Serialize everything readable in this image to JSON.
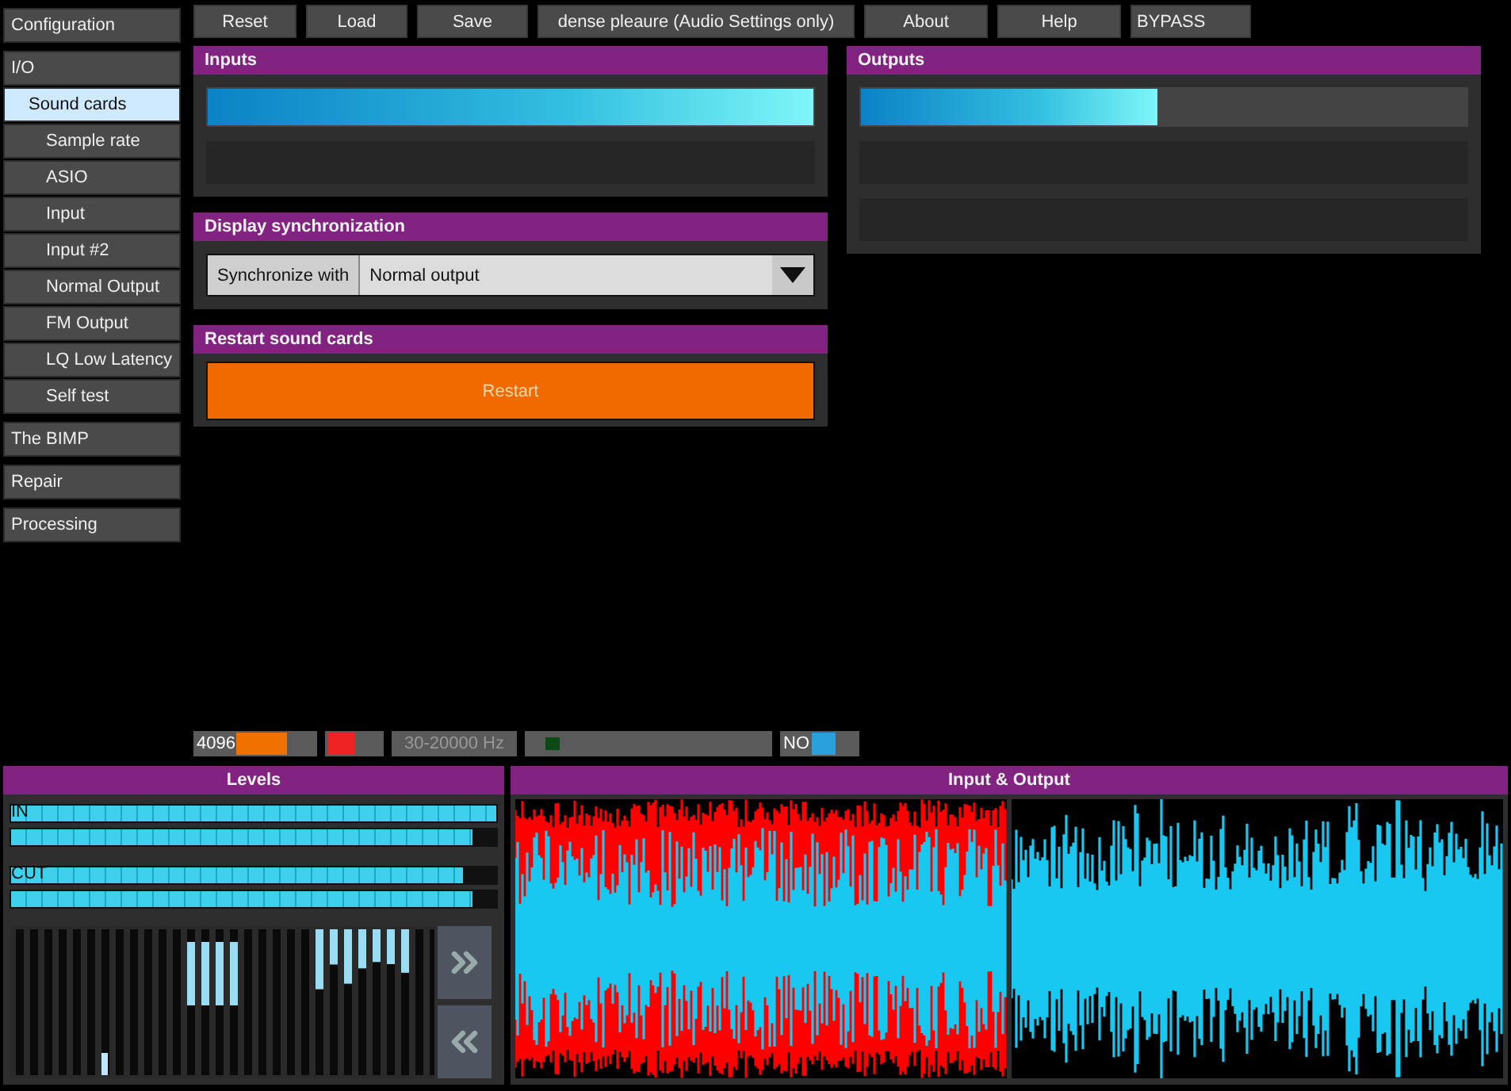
{
  "sidebar": {
    "items": [
      {
        "label": "Configuration",
        "selected": false
      },
      {
        "label": "I/O",
        "selected": false,
        "children": [
          {
            "label": "Sound cards",
            "selected": true,
            "children": [
              {
                "label": "Sample rate",
                "selected": false
              },
              {
                "label": "ASIO",
                "selected": false
              },
              {
                "label": "Input",
                "selected": false
              },
              {
                "label": "Input #2",
                "selected": false
              },
              {
                "label": "Normal Output",
                "selected": false
              },
              {
                "label": "FM Output",
                "selected": false
              },
              {
                "label": "LQ Low Latency",
                "selected": false
              },
              {
                "label": "Self test",
                "selected": false
              }
            ]
          }
        ]
      },
      {
        "label": "The BIMP",
        "selected": false
      },
      {
        "label": "Repair",
        "selected": false
      },
      {
        "label": "Processing",
        "selected": false
      }
    ]
  },
  "toolbar": {
    "buttons": [
      "Reset",
      "Load",
      "Save",
      "dense pleaure (Audio Settings only)",
      "About",
      "Help"
    ],
    "bypass": "BYPASS"
  },
  "inputs": {
    "title": "Inputs",
    "meters": [
      {
        "kind": "bar",
        "level": 1
      },
      {
        "kind": "empty"
      }
    ]
  },
  "display_sync": {
    "title": "Display synchronization",
    "label": "Synchronize with",
    "value": "Normal output"
  },
  "restart": {
    "title": "Restart sound cards",
    "button": "Restart"
  },
  "outputs": {
    "title": "Outputs",
    "meters": [
      {
        "kind": "bar",
        "level": 0.49
      },
      {
        "kind": "empty"
      },
      {
        "kind": "empty"
      }
    ]
  },
  "status_bar": [
    {
      "kind": "meter",
      "label": "4096",
      "level": 0.64,
      "color": "#f07000"
    },
    {
      "kind": "meter",
      "level": 0.5,
      "color": "#ee2222"
    },
    {
      "kind": "text",
      "label": "30-20000 Hz"
    },
    {
      "kind": "indicator",
      "color": "#0a4a14"
    },
    {
      "kind": "meter",
      "label": "NO",
      "level": 0.5,
      "color": "#2aa0dd"
    }
  ],
  "levels": {
    "title": "Levels",
    "rows": [
      {
        "label": "IN",
        "level": 1
      },
      {
        "level": 0.95
      },
      {
        "label": "CUT",
        "level": 0.93
      },
      {
        "level": 0.95
      }
    ]
  },
  "input_output": {
    "title": "Input & Output"
  }
}
